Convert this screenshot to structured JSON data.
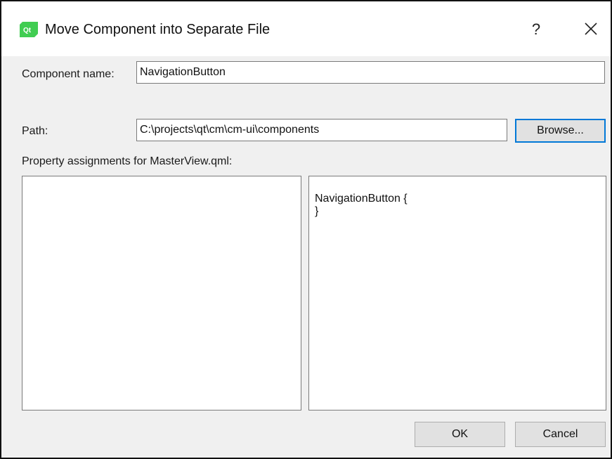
{
  "window": {
    "title": "Move Component into Separate File",
    "help_label": "?",
    "app_icon": "qt-creator-icon",
    "close_icon": "close-icon"
  },
  "form": {
    "component_name_label": "Component name:",
    "component_name_value": "NavigationButton",
    "path_label": "Path:",
    "path_value": "C:\\projects\\qt\\cm\\cm-ui\\components",
    "browse_label": "Browse...",
    "property_assignments_label": "Property assignments for MasterView.qml:"
  },
  "preview": {
    "lines": [
      "NavigationButton {",
      "}"
    ]
  },
  "footer": {
    "ok_label": "OK",
    "cancel_label": "Cancel"
  },
  "colors": {
    "accent": "#0078d7",
    "app_icon_green": "#41cd52",
    "dialog_background": "#f0f0f0"
  }
}
